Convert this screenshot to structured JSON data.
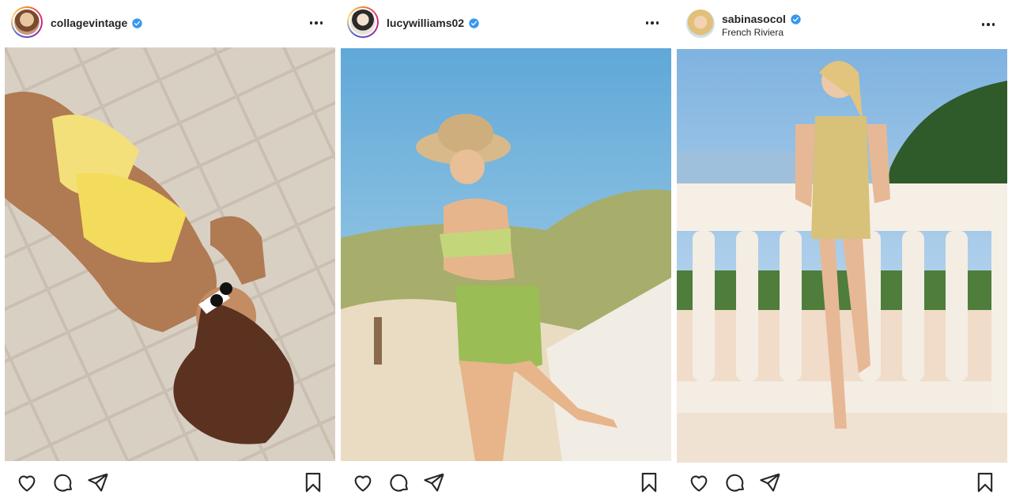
{
  "posts": [
    {
      "username": "collagevintage",
      "verified": true,
      "location": "",
      "avatar_ring": "story",
      "photo": {
        "description_icon": "beach-photo",
        "palette": [
          "#d8cdbf",
          "#f0d54a",
          "#6b3b22"
        ]
      }
    },
    {
      "username": "lucywilliams02",
      "verified": true,
      "location": "",
      "avatar_ring": "story",
      "photo": {
        "description_icon": "beach-photo",
        "palette": [
          "#7fb9de",
          "#a8b46a",
          "#e9dcc6"
        ]
      }
    },
    {
      "username": "sabinasocol",
      "verified": true,
      "location": "French Riviera",
      "avatar_ring": "none",
      "photo": {
        "description_icon": "balcony-photo",
        "palette": [
          "#9fc8ea",
          "#f3ebe0",
          "#2f5a2a"
        ]
      }
    }
  ],
  "icons": {
    "like": "heart-icon",
    "comment": "comment-icon",
    "share": "paper-plane-icon",
    "save": "bookmark-icon",
    "more": "more-options-icon",
    "verified": "verified-badge-icon"
  },
  "colors": {
    "text": "#262626",
    "verified_blue": "#3897f0",
    "background": "#ffffff"
  }
}
